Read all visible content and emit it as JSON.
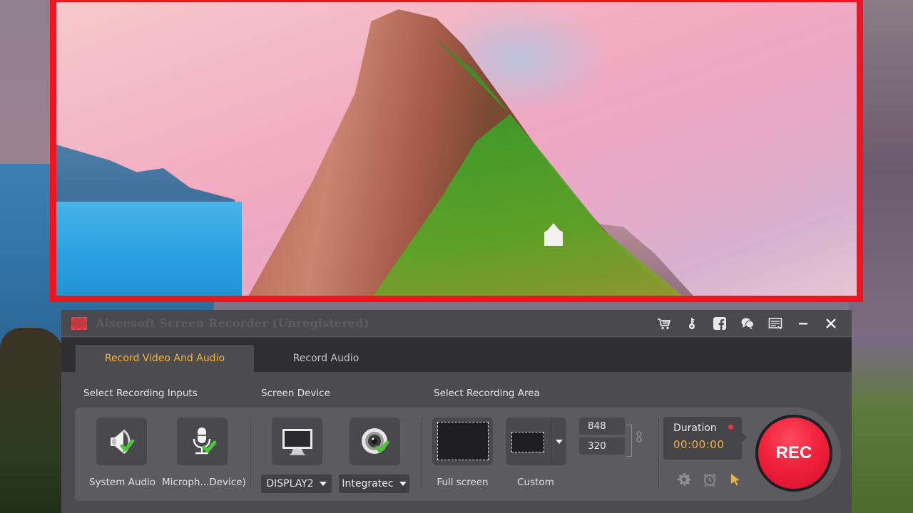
{
  "window": {
    "title": "Aiseesoft Screen Recorder (Unregistered)",
    "toolbar_icons": [
      "cart-icon",
      "key-icon",
      "facebook-icon",
      "feedback-icon",
      "menu-icon",
      "minimize-icon",
      "close-icon"
    ]
  },
  "tabs": [
    {
      "label": "Record Video And Audio",
      "active": true
    },
    {
      "label": "Record Audio",
      "active": false
    }
  ],
  "sections": {
    "inputs_label": "Select Recording Inputs",
    "screen_device_label": "Screen Device",
    "area_label": "Select Recording Area"
  },
  "inputs": [
    {
      "label": "System Audio",
      "icon": "speaker-icon",
      "checked": true
    },
    {
      "label": "Microph...Device)",
      "icon": "microphone-icon",
      "checked": true
    }
  ],
  "screen_device": {
    "display": {
      "icon": "monitor-icon",
      "selected": "DISPLAY2"
    },
    "webcam": {
      "icon": "webcam-icon",
      "selected": "Integratec",
      "checked": true
    }
  },
  "recording_area": {
    "full_screen_label": "Full screen",
    "custom_label": "Custom",
    "width": "848",
    "height": "320"
  },
  "duration": {
    "label": "Duration",
    "time": "00:00:00"
  },
  "rec_button": {
    "label": "REC"
  },
  "colors": {
    "accent": "#f3b33d",
    "rec_red": "#f0213c",
    "frame_red": "#f0141e",
    "check_green": "#4cc53a"
  }
}
